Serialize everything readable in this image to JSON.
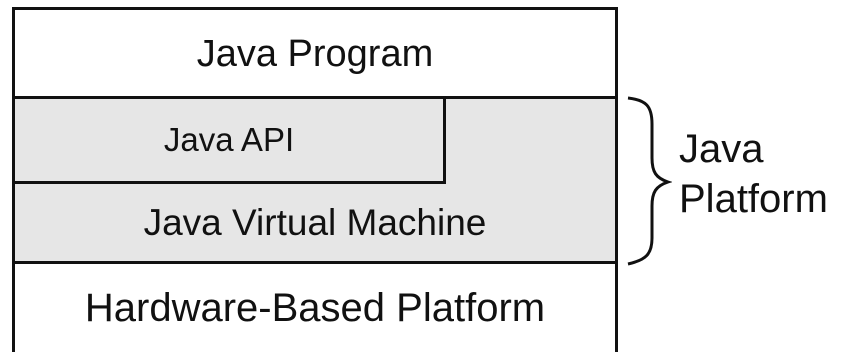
{
  "diagram": {
    "layers": {
      "program": "Java Program",
      "api": "Java API",
      "jvm": "Java Virtual Machine",
      "hardware": "Hardware-Based Platform"
    },
    "brace_label": {
      "line1": "Java",
      "line2": "Platform"
    }
  }
}
